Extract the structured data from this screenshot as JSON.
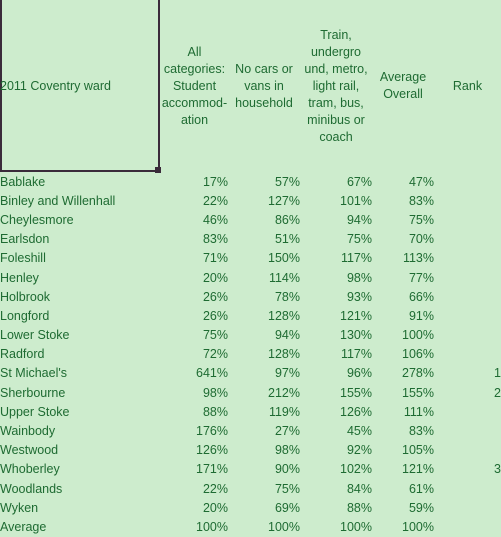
{
  "table": {
    "headers": {
      "ward": "2011 Coventry ward",
      "col1": "All categories: Student accommod- ation",
      "col2": "No cars or vans in household",
      "col3": "Train, undergro und, metro, light rail, tram, bus, minibus or coach",
      "col4": "Average Overall",
      "rank": "Rank"
    },
    "rows": [
      {
        "ward": "Bablake",
        "col1": "17%",
        "col2": "57%",
        "col3": "67%",
        "col4": "47%",
        "rank": ""
      },
      {
        "ward": "Binley and Willenhall",
        "col1": "22%",
        "col2": "127%",
        "col3": "101%",
        "col4": "83%",
        "rank": ""
      },
      {
        "ward": "Cheylesmore",
        "col1": "46%",
        "col2": "86%",
        "col3": "94%",
        "col4": "75%",
        "rank": ""
      },
      {
        "ward": "Earlsdon",
        "col1": "83%",
        "col2": "51%",
        "col3": "75%",
        "col4": "70%",
        "rank": ""
      },
      {
        "ward": "Foleshill",
        "col1": "71%",
        "col2": "150%",
        "col3": "117%",
        "col4": "113%",
        "rank": ""
      },
      {
        "ward": "Henley",
        "col1": "20%",
        "col2": "114%",
        "col3": "98%",
        "col4": "77%",
        "rank": ""
      },
      {
        "ward": "Holbrook",
        "col1": "26%",
        "col2": "78%",
        "col3": "93%",
        "col4": "66%",
        "rank": ""
      },
      {
        "ward": "Longford",
        "col1": "26%",
        "col2": "128%",
        "col3": "121%",
        "col4": "91%",
        "rank": ""
      },
      {
        "ward": "Lower Stoke",
        "col1": "75%",
        "col2": "94%",
        "col3": "130%",
        "col4": "100%",
        "rank": ""
      },
      {
        "ward": "Radford",
        "col1": "72%",
        "col2": "128%",
        "col3": "117%",
        "col4": "106%",
        "rank": ""
      },
      {
        "ward": "St Michael's",
        "col1": "641%",
        "col2": "97%",
        "col3": "96%",
        "col4": "278%",
        "rank": "1"
      },
      {
        "ward": "Sherbourne",
        "col1": "98%",
        "col2": "212%",
        "col3": "155%",
        "col4": "155%",
        "rank": "2"
      },
      {
        "ward": "Upper Stoke",
        "col1": "88%",
        "col2": "119%",
        "col3": "126%",
        "col4": "111%",
        "rank": ""
      },
      {
        "ward": "Wainbody",
        "col1": "176%",
        "col2": "27%",
        "col3": "45%",
        "col4": "83%",
        "rank": ""
      },
      {
        "ward": "Westwood",
        "col1": "126%",
        "col2": "98%",
        "col3": "92%",
        "col4": "105%",
        "rank": ""
      },
      {
        "ward": "Whoberley",
        "col1": "171%",
        "col2": "90%",
        "col3": "102%",
        "col4": "121%",
        "rank": "3"
      },
      {
        "ward": "Woodlands",
        "col1": "22%",
        "col2": "75%",
        "col3": "84%",
        "col4": "61%",
        "rank": ""
      },
      {
        "ward": "Wyken",
        "col1": "20%",
        "col2": "69%",
        "col3": "88%",
        "col4": "59%",
        "rank": ""
      },
      {
        "ward": "Average",
        "col1": "100%",
        "col2": "100%",
        "col3": "100%",
        "col4": "100%",
        "rank": ""
      }
    ]
  },
  "colors": {
    "background": "#cdeccd",
    "text": "#1e6b32",
    "selection_border": "#3a2b3a"
  }
}
